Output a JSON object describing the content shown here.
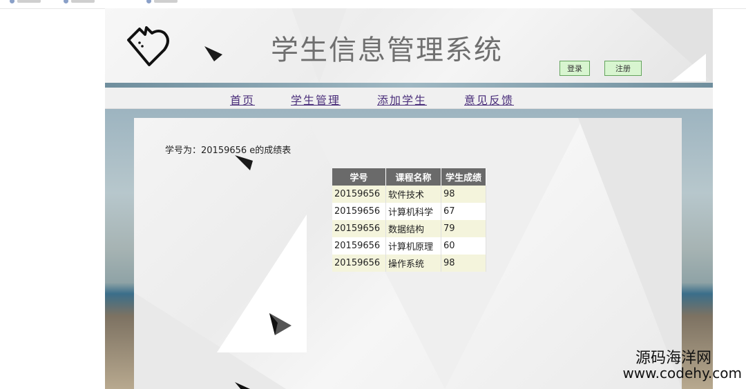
{
  "header": {
    "title": "学生信息管理系统",
    "login_label": "登录",
    "register_label": "注册"
  },
  "nav": {
    "items": [
      {
        "label": "首页"
      },
      {
        "label": "学生管理"
      },
      {
        "label": "添加学生"
      },
      {
        "label": "意见反馈"
      }
    ]
  },
  "main": {
    "caption": "学号为：20159656 e的成绩表",
    "table": {
      "headers": [
        "学号",
        "课程名称",
        "学生成绩"
      ],
      "rows": [
        [
          "20159656",
          "软件技术",
          "98"
        ],
        [
          "20159656",
          "计算机科学",
          "67"
        ],
        [
          "20159656",
          "数据结构",
          "79"
        ],
        [
          "20159656",
          "计算机原理",
          "60"
        ],
        [
          "20159656",
          "操作系统",
          "98"
        ]
      ]
    }
  },
  "watermark": {
    "name": "源码海洋网",
    "url": "www.codehy.com"
  },
  "colors": {
    "nav_link": "#4a2e7a",
    "table_header": "#6a6a6a",
    "row_highlight": "#f4f4dc",
    "button_bg": "#d8f5d0"
  }
}
